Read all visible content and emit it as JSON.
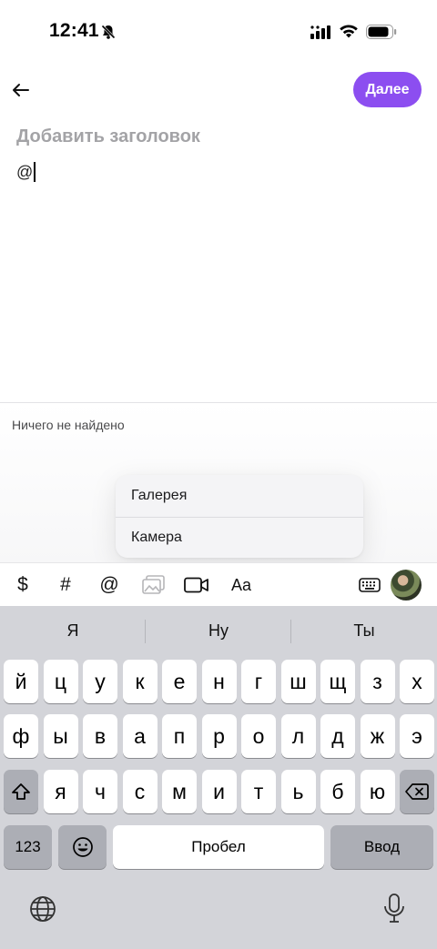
{
  "status_bar": {
    "time": "12:41"
  },
  "header": {
    "next_label": "Далее"
  },
  "editor": {
    "title_placeholder": "Добавить заголовок",
    "body_text": "@"
  },
  "mention_panel": {
    "empty_text": "Ничего не найдено"
  },
  "media_menu": {
    "items": [
      "Галерея",
      "Камера"
    ]
  },
  "toolbar": {
    "dollar": "$",
    "hash": "#",
    "at": "@",
    "font": "Aa"
  },
  "keyboard": {
    "predictions": [
      "Я",
      "Ну",
      "Ты"
    ],
    "row1": [
      "й",
      "ц",
      "у",
      "к",
      "е",
      "н",
      "г",
      "ш",
      "щ",
      "з",
      "х"
    ],
    "row2": [
      "ф",
      "ы",
      "в",
      "а",
      "п",
      "р",
      "о",
      "л",
      "д",
      "ж",
      "э"
    ],
    "row3": [
      "я",
      "ч",
      "с",
      "м",
      "и",
      "т",
      "ь",
      "б",
      "ю"
    ],
    "numbers_label": "123",
    "space_label": "Пробел",
    "return_label": "Ввод"
  },
  "colors": {
    "accent": "#8c4ef0",
    "keyboard_bg": "#d3d4d9",
    "func_key": "#acaeb5"
  }
}
